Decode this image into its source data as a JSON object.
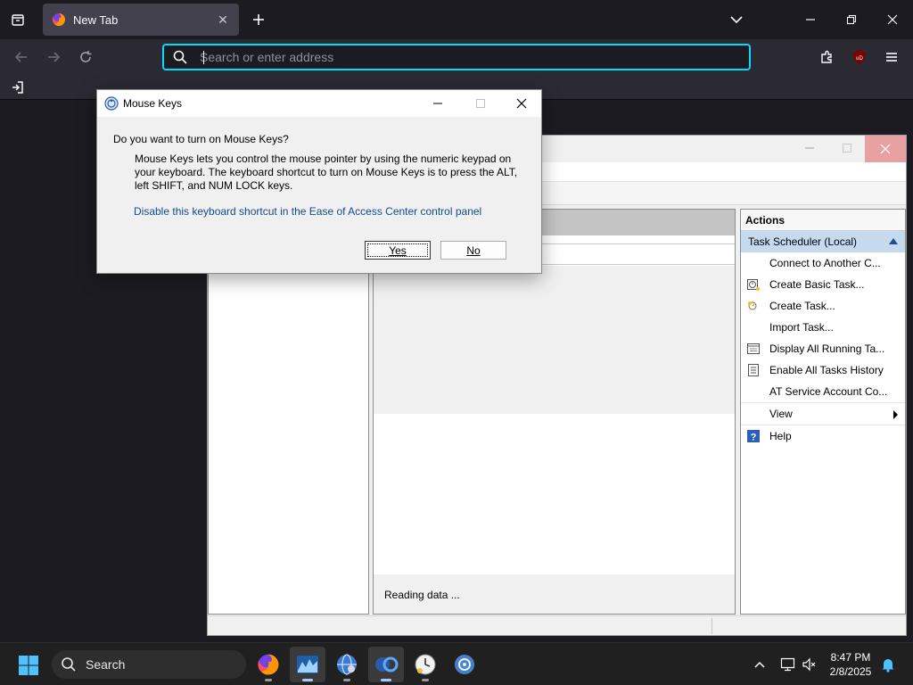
{
  "browser": {
    "tab_title": "New Tab",
    "address_placeholder": "Search or enter address",
    "accent_color": "#00ddff"
  },
  "mouse_keys_dialog": {
    "title": "Mouse Keys",
    "question": "Do you want to turn on Mouse Keys?",
    "description": "Mouse Keys lets you control the mouse pointer by using the numeric keypad on your keyboard.  The keyboard shortcut to turn on Mouse Keys is to press the ALT, left SHIFT, and NUM LOCK keys.",
    "link": "Disable this keyboard shortcut in the Ease of Access Center control panel",
    "yes_button": "Yes",
    "no_button": "No"
  },
  "task_scheduler": {
    "status_text": "Reading data ...",
    "actions": {
      "header": "Actions",
      "section": "Task Scheduler (Local)",
      "items": [
        {
          "label": "Connect to Another C...",
          "icon": "none"
        },
        {
          "label": "Create Basic Task...",
          "icon": "basic-task-icon"
        },
        {
          "label": "Create Task...",
          "icon": "create-task-icon"
        },
        {
          "label": "Import Task...",
          "icon": "none"
        },
        {
          "label": "Display All Running Ta...",
          "icon": "running-tasks-icon"
        },
        {
          "label": "Enable All Tasks History",
          "icon": "history-icon"
        },
        {
          "label": "AT Service Account Co...",
          "icon": "none"
        },
        {
          "label": "View",
          "icon": "none"
        },
        {
          "label": "Help",
          "icon": "help-icon"
        }
      ]
    }
  },
  "taskbar": {
    "search_label": "Search",
    "time": "8:47 PM",
    "date": "2/8/2025"
  }
}
